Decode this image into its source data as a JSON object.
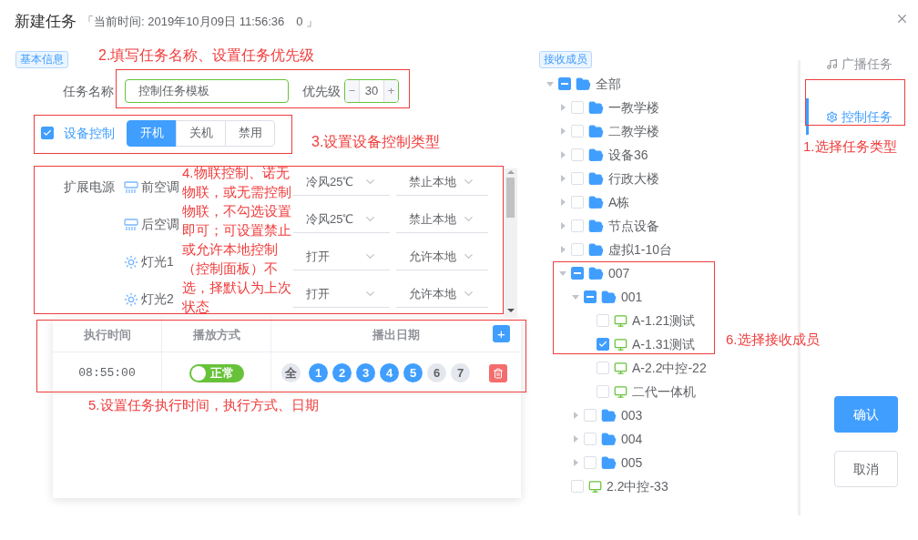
{
  "dialog": {
    "title": "新建任务",
    "current_time": "「当前时间: 2019年10月09日 11:56:36　0 」"
  },
  "basic_info": {
    "tag": "基本信息",
    "task_name_label": "任务名称",
    "task_name": "控制任务模板",
    "priority_label": "优先级",
    "decrement": "−",
    "priority": "30",
    "increment": "+"
  },
  "device_control": {
    "checked": true,
    "label": "设备控制",
    "modes": [
      {
        "label": "开机",
        "selected": true
      },
      {
        "label": "关机",
        "selected": false
      },
      {
        "label": "禁用",
        "selected": false
      }
    ]
  },
  "extension": {
    "label": "扩展电源",
    "devices": [
      {
        "kind": "ac",
        "name": "前空调",
        "setting": "冷风25℃",
        "local": "禁止本地"
      },
      {
        "kind": "ac",
        "name": "后空调",
        "setting": "冷风25℃",
        "local": "禁止本地"
      },
      {
        "kind": "light",
        "name": "灯光1",
        "setting": "打开",
        "local": "允许本地"
      },
      {
        "kind": "light",
        "name": "灯光2",
        "setting": "打开",
        "local": "允许本地"
      }
    ]
  },
  "schedule": {
    "columns": [
      "执行时间",
      "播放方式",
      "播出日期"
    ],
    "add": "+",
    "rows": [
      {
        "time": "08:55:00",
        "mode": {
          "label": "正常",
          "on": true
        },
        "days": [
          {
            "label": "全",
            "selected": false
          },
          {
            "label": "1",
            "selected": true
          },
          {
            "label": "2",
            "selected": true
          },
          {
            "label": "3",
            "selected": true
          },
          {
            "label": "4",
            "selected": true
          },
          {
            "label": "5",
            "selected": true
          },
          {
            "label": "6",
            "selected": false
          },
          {
            "label": "7",
            "selected": false
          }
        ]
      }
    ]
  },
  "members": {
    "tag": "接收成员",
    "tree": [
      {
        "label": "全部",
        "kind": "folder",
        "expanded": true,
        "indeterminate": true,
        "children": [
          {
            "label": "一教学楼",
            "kind": "folder",
            "expanded": false,
            "checked": false,
            "indeterminate": false
          },
          {
            "label": "二教学楼",
            "kind": "folder",
            "expanded": false,
            "checked": false,
            "indeterminate": false
          },
          {
            "label": "设备36",
            "kind": "folder",
            "expanded": false,
            "checked": false,
            "indeterminate": false
          },
          {
            "label": "行政大楼",
            "kind": "folder",
            "expanded": false,
            "checked": false,
            "indeterminate": false
          },
          {
            "label": "A栋",
            "kind": "folder",
            "expanded": false,
            "checked": false,
            "indeterminate": false
          },
          {
            "label": "节点设备",
            "kind": "folder",
            "expanded": false,
            "checked": false,
            "indeterminate": false
          },
          {
            "label": "虚拟1-10台",
            "kind": "folder",
            "expanded": false,
            "checked": false,
            "indeterminate": false
          },
          {
            "label": "007",
            "kind": "folder",
            "expanded": true,
            "indeterminate": true,
            "children": [
              {
                "label": "001",
                "kind": "folder",
                "expanded": true,
                "indeterminate": true,
                "children": [
                  {
                    "label": "A-1.21测试",
                    "kind": "device",
                    "checked": false
                  },
                  {
                    "label": "A-1.31测试",
                    "kind": "device",
                    "checked": true
                  },
                  {
                    "label": "A-2.2中控-22",
                    "kind": "device",
                    "checked": false
                  },
                  {
                    "label": "二代一体机",
                    "kind": "device",
                    "checked": false
                  }
                ]
              },
              {
                "label": "003",
                "kind": "folder",
                "expanded": false,
                "checked": false,
                "indeterminate": false
              },
              {
                "label": "004",
                "kind": "folder",
                "expanded": false,
                "checked": false,
                "indeterminate": false
              },
              {
                "label": "005",
                "kind": "folder",
                "expanded": false,
                "checked": false,
                "indeterminate": false
              }
            ]
          },
          {
            "label": "2.2中控-33",
            "kind": "device",
            "checked": false
          }
        ]
      }
    ]
  },
  "task_types": [
    {
      "kind": "music",
      "label": "广播任务",
      "selected": false
    },
    {
      "kind": "control",
      "label": "控制任务",
      "selected": true
    }
  ],
  "buttons": {
    "confirm": "确认",
    "cancel": "取消"
  },
  "annotations": [
    "1.选择任务类型",
    "2.填写任务名称、设置任务优先级",
    "3.设置设备控制类型",
    "4.物联控制、诺无物联，或无需控制物联，不勾选设置即可；可设置禁止或允许本地控制（控制面板）不选，择默认为上次状态",
    "5.设置任务执行时间，执行方式、日期",
    "6.选择接收成员"
  ]
}
